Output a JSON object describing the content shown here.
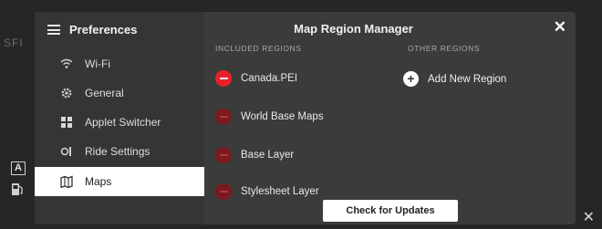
{
  "background": {
    "peek_text": "SFI",
    "close_glyph": "✕"
  },
  "modal": {
    "title": "Map Region Manager",
    "close_glyph": "✕"
  },
  "sidebar": {
    "title": "Preferences",
    "items": [
      {
        "label": "Wi-Fi",
        "icon": "wifi-icon",
        "active": false
      },
      {
        "label": "General",
        "icon": "gear-icon",
        "active": false
      },
      {
        "label": "Applet Switcher",
        "icon": "grid-icon",
        "active": false
      },
      {
        "label": "Ride Settings",
        "icon": "ride-settings-icon",
        "active": false
      },
      {
        "label": "Maps",
        "icon": "map-icon",
        "active": true
      }
    ]
  },
  "included_regions": {
    "heading": "INCLUDED REGIONS",
    "items": [
      {
        "label": "Canada.PEI",
        "icon_color": "#e8202a"
      },
      {
        "label": "World Base Maps",
        "icon_color": "#7a1a1f"
      },
      {
        "label": "Base Layer",
        "icon_color": "#7a1a1f"
      },
      {
        "label": "Stylesheet Layer",
        "icon_color": "#7a1a1f"
      }
    ]
  },
  "other_regions": {
    "heading": "OTHER REGIONS",
    "add_label": "Add New Region",
    "add_glyph": "+"
  },
  "footer": {
    "check_updates_label": "Check for Updates"
  },
  "colors": {
    "accent_remove": "#e8202a",
    "remove_dim": "#7a1a1f",
    "active_bg": "#ffffff"
  }
}
